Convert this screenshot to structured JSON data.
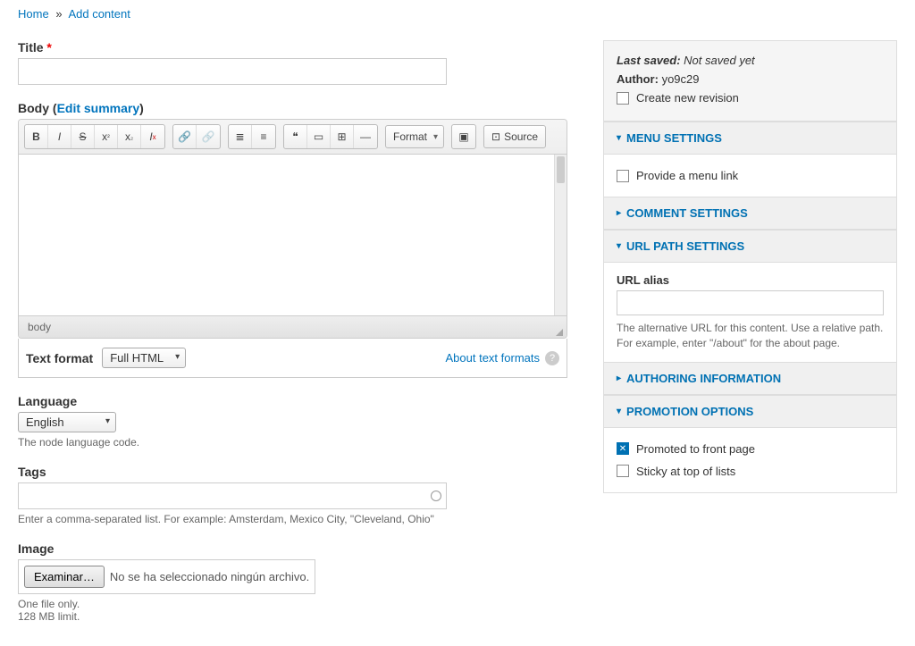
{
  "breadcrumb": {
    "home": "Home",
    "sep": "»",
    "current": "Add content"
  },
  "form": {
    "title_label": "Title",
    "body_label": "Body",
    "edit_summary": "Edit summary",
    "path_text": "body",
    "toolbar": {
      "format": "Format",
      "source": "Source"
    },
    "text_format_label": "Text format",
    "text_format_value": "Full HTML",
    "about_formats": "About text formats",
    "language_label": "Language",
    "language_value": "English",
    "language_desc": "The node language code.",
    "tags_label": "Tags",
    "tags_desc": "Enter a comma-separated list. For example: Amsterdam, Mexico City, \"Cleveland, Ohio\"",
    "image_label": "Image",
    "file_button": "Examinar…",
    "file_text": "No se ha seleccionado ningún archivo.",
    "file_desc1": "One file only.",
    "file_desc2": "128 MB limit."
  },
  "sidebar": {
    "meta": {
      "last_saved_label": "Last saved:",
      "last_saved_value": "Not saved yet",
      "author_label": "Author:",
      "author_value": "yo9c29",
      "revision_label": "Create new revision"
    },
    "menu": {
      "title": "MENU SETTINGS",
      "provide_link": "Provide a menu link"
    },
    "comment": {
      "title": "COMMENT SETTINGS"
    },
    "url": {
      "title": "URL PATH SETTINGS",
      "alias_label": "URL alias",
      "desc": "The alternative URL for this content. Use a relative path. For example, enter \"/about\" for the about page."
    },
    "authoring": {
      "title": "AUTHORING INFORMATION"
    },
    "promo": {
      "title": "PROMOTION OPTIONS",
      "promoted": "Promoted to front page",
      "sticky": "Sticky at top of lists"
    }
  }
}
